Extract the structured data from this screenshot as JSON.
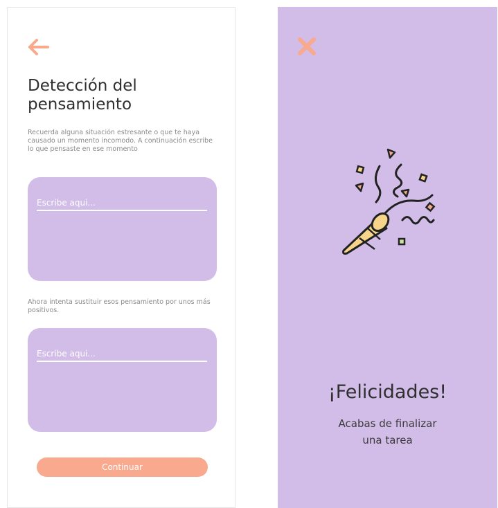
{
  "left_screen": {
    "title": "Detección del pensamiento",
    "instruction_1": "Recuerda alguna situación estresante o que te haya causado un momento incomodo. A continuación escribe lo que pensaste en ese momento",
    "field_1_placeholder": "Escribe aqui...",
    "instruction_2": "Ahora intenta sustituir esos pensamiento por unos más positivos.",
    "field_2_placeholder": "Escribe aqui...",
    "continue_label": "Continuar",
    "icons": {
      "back": "arrow-left-icon"
    }
  },
  "right_screen": {
    "heading": "¡Felicidades!",
    "line1": "Acabas de finalizar",
    "line2": "una tarea",
    "icons": {
      "close": "close-icon",
      "illustration": "party-popper-icon"
    }
  },
  "colors": {
    "accent": "#f9a98e",
    "card": "#d1bde8",
    "background_right": "#d2bde8",
    "text_dark": "#2f2f2f",
    "text_muted": "#8a8a8a"
  }
}
